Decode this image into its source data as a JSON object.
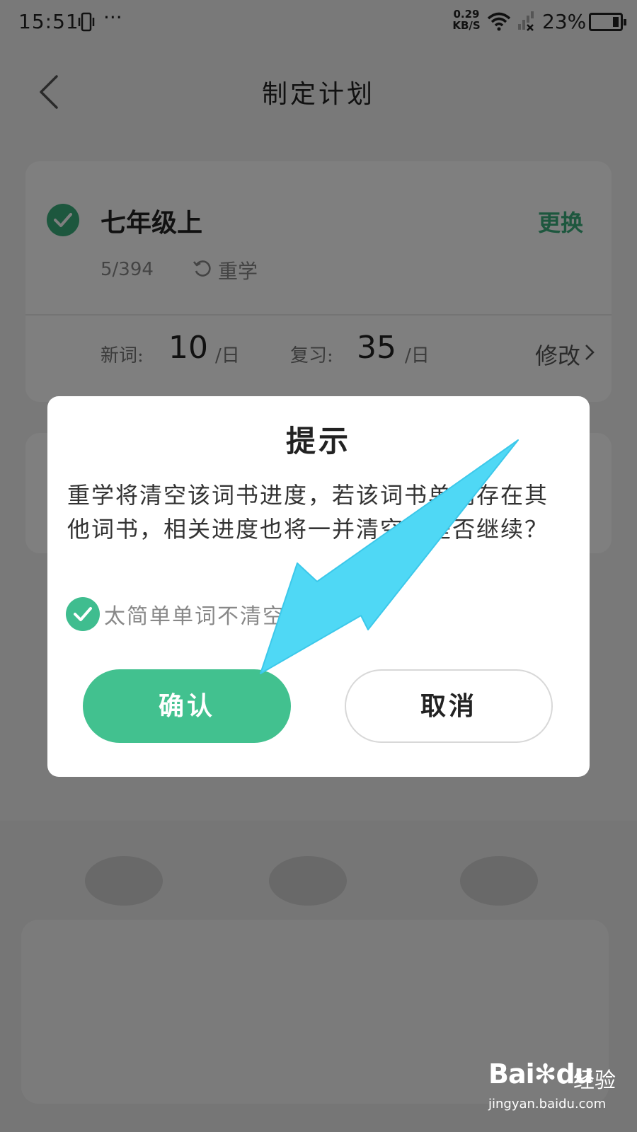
{
  "status_bar": {
    "time": "15:51",
    "dots": "···",
    "net_speed_value": "0.29",
    "net_speed_unit": "KB/S",
    "battery_pct": "23%"
  },
  "header": {
    "title": "制定计划"
  },
  "plan_card": {
    "book_name": "七年级上",
    "change_label": "更换",
    "progress": "5/394",
    "relearn_label": "重学",
    "new_words_label": "新词:",
    "new_words_value": "10",
    "new_words_unit": "/日",
    "review_label": "复习:",
    "review_value": "35",
    "review_unit": "/日",
    "edit_label": "修改"
  },
  "dialog": {
    "title": "提示",
    "message": "重学将清空该词书进度，若该词书单词存在其他词书，相关进度也将一并清空，是否继续？",
    "keep_easy_label": "太简单单词不清空",
    "keep_easy_checked": true,
    "confirm_label": "确认",
    "cancel_label": "取消"
  },
  "watermark": {
    "logo": "Bai",
    "logo_suffix": "du",
    "text": "经验",
    "url": "jingyan.baidu.com"
  },
  "colors": {
    "accent": "#42c18f",
    "check": "#3aae7d",
    "arrow": "#4fd8f5"
  }
}
